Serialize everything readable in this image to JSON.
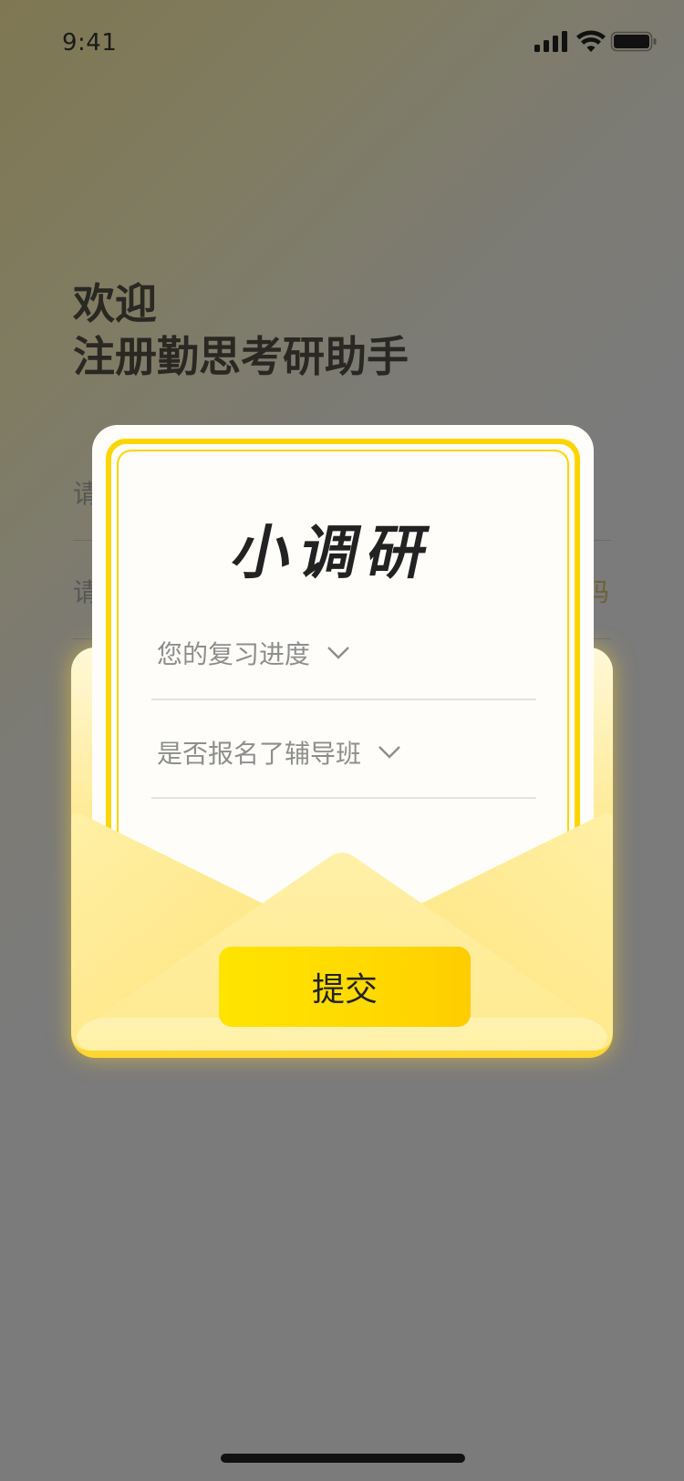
{
  "status_bar": {
    "time": "9:41"
  },
  "background_page": {
    "welcome_line1": "欢迎",
    "welcome_line2": "注册勤思考研助手",
    "field1_hint": "请",
    "field2_hint": "请",
    "code_link_fragment": "码"
  },
  "survey_modal": {
    "title": "小调研",
    "progress_select": {
      "label": "您的复习进度"
    },
    "tutoring_select": {
      "label": "是否报名了辅导班"
    },
    "submit_label": "提交"
  },
  "colors": {
    "accent_yellow": "#ffd500",
    "card_bg": "#fefdf9",
    "overlay_gray": "#7b7b7b"
  }
}
